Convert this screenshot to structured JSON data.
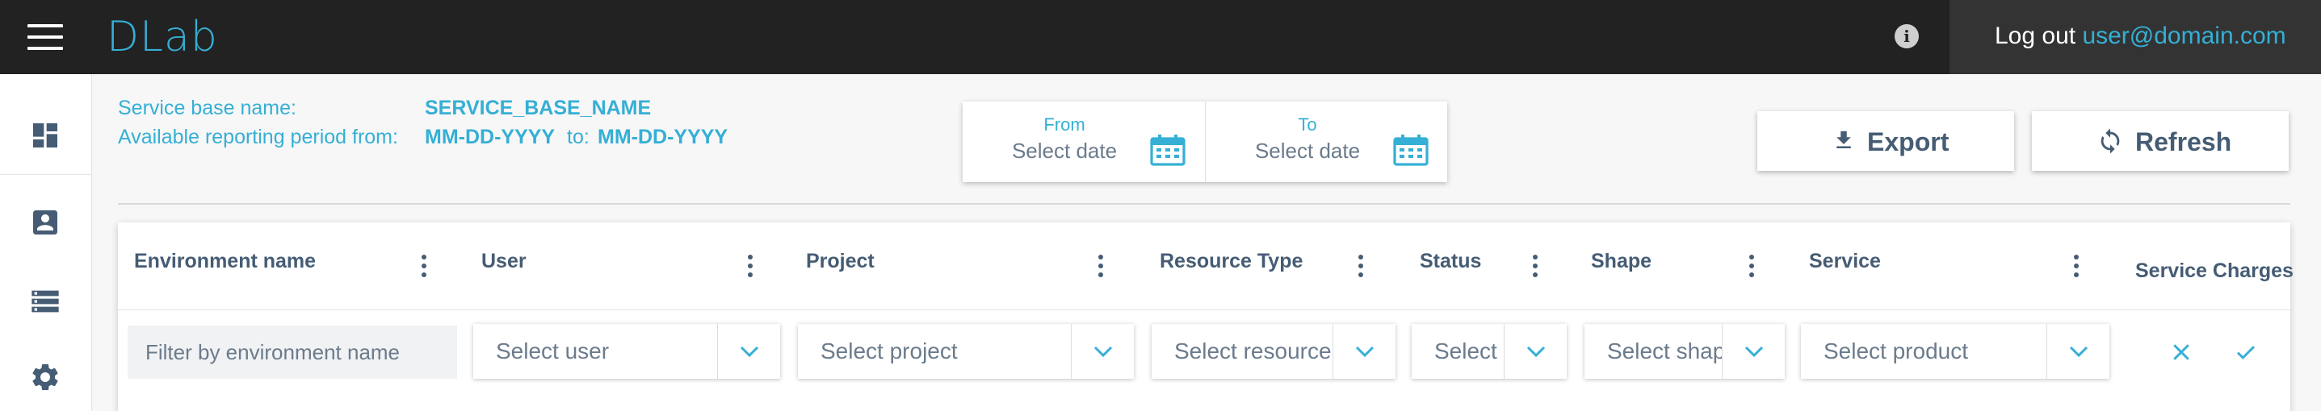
{
  "app": {
    "logo": "DLab"
  },
  "header": {
    "logout_label": "Log out",
    "user_email": "user@domain.com"
  },
  "icons": {
    "menu": "hamburger-menu-icon",
    "info": "info-icon",
    "sidebar": [
      "dashboard-icon",
      "account-box-icon",
      "storage-icon",
      "settings-icon"
    ],
    "calendar": "calendar-icon",
    "export": "download-icon",
    "refresh": "refresh-icon",
    "column_menu": "more-vert-icon",
    "dropdown": "chevron-down-icon",
    "clear": "close-icon",
    "apply": "check-icon"
  },
  "info": {
    "service_label": "Service base name:",
    "service_value": "SERVICE_BASE_NAME",
    "period_label": "Available reporting period from:",
    "period_from": "MM-DD-YYYY",
    "period_to_label": "to:",
    "period_to": "MM-DD-YYYY"
  },
  "date_range": {
    "from_label": "From",
    "from_placeholder": "Select date",
    "to_label": "To",
    "to_placeholder": "Select date"
  },
  "actions": {
    "export_label": "Export",
    "refresh_label": "Refresh"
  },
  "table": {
    "columns": [
      "Environment name",
      "User",
      "Project",
      "Resource Type",
      "Status",
      "Shape",
      "Service",
      "Service Charges"
    ],
    "filters": {
      "environment_placeholder": "Filter by environment name",
      "user": "Select user",
      "project": "Select project",
      "resource_type": "Select resource",
      "status": "Select",
      "shape": "Select shap",
      "service": "Select product"
    }
  },
  "colors": {
    "accent": "#35afd5",
    "topbar": "#222222",
    "text": "#455c74"
  }
}
